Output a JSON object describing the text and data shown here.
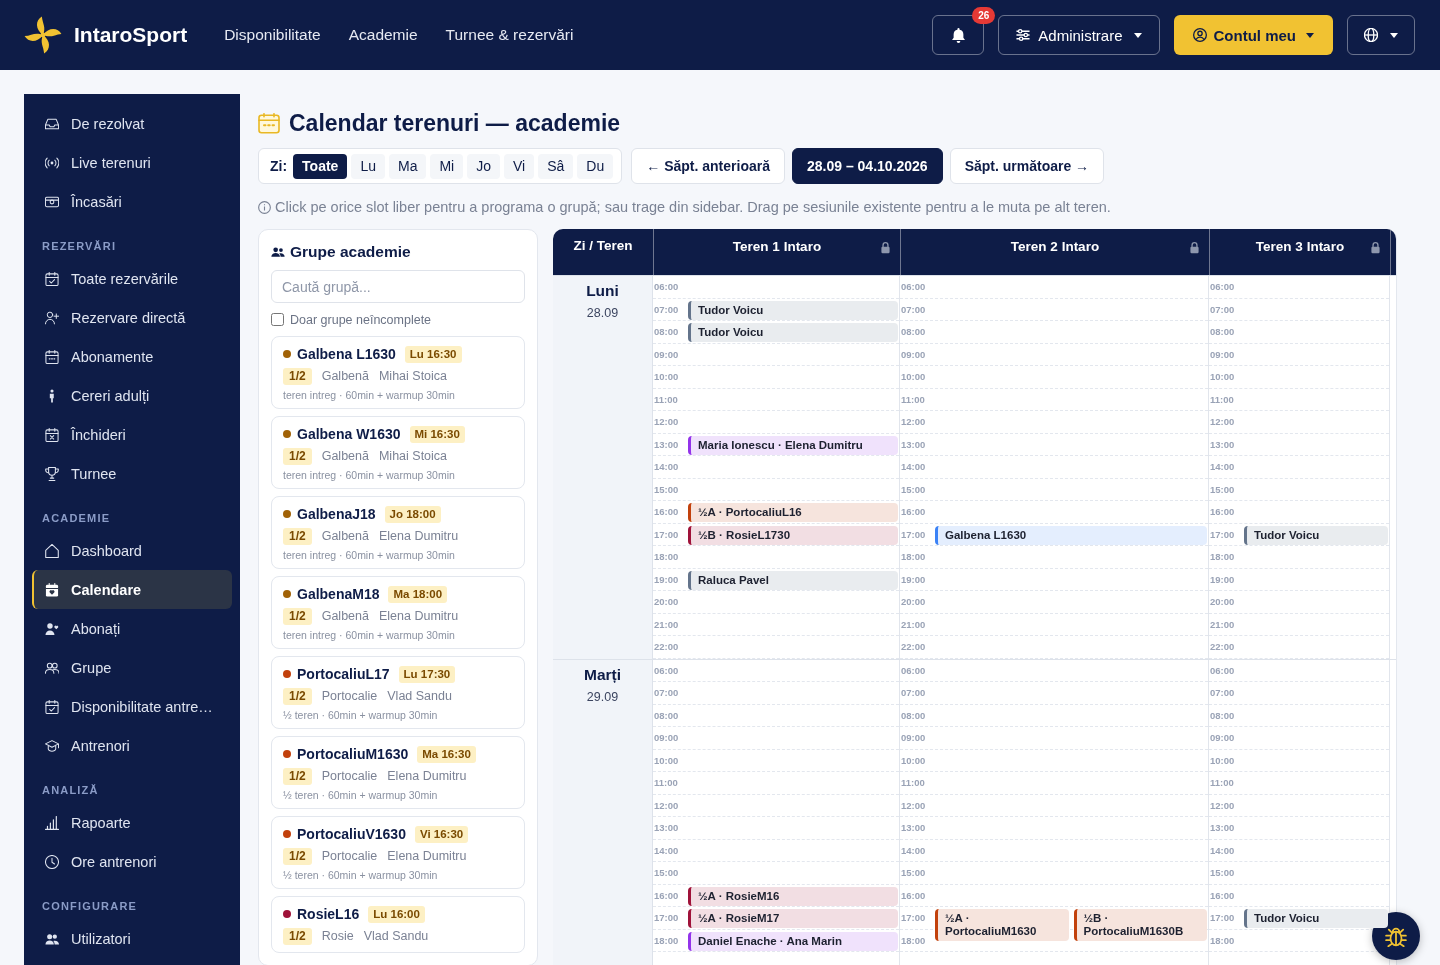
{
  "topbar": {
    "brand": "IntaroSport",
    "nav": [
      "Disponibilitate",
      "Academie",
      "Turnee & rezervări"
    ],
    "notifications": {
      "count": "26"
    },
    "admin_menu": {
      "label": "Administrare"
    },
    "account_menu": {
      "label": "Contul meu"
    }
  },
  "sidebar": {
    "sections": [
      {
        "items": [
          {
            "label": "De rezolvat",
            "selected": false
          },
          {
            "label": "Live terenuri",
            "selected": false
          },
          {
            "label": "Încasări",
            "selected": false
          }
        ]
      },
      {
        "title": "REZERVĂRI",
        "items": [
          {
            "label": "Toate rezervările",
            "selected": false
          },
          {
            "label": "Rezervare directă",
            "selected": false
          },
          {
            "label": "Abonamente",
            "selected": false
          },
          {
            "label": "Cereri adulți",
            "selected": false
          },
          {
            "label": "Închideri",
            "selected": false
          },
          {
            "label": "Turnee",
            "selected": false
          }
        ]
      },
      {
        "title": "ACADEMIE",
        "items": [
          {
            "label": "Dashboard",
            "selected": false
          },
          {
            "label": "Calendare",
            "selected": true
          },
          {
            "label": "Abonați",
            "selected": false
          },
          {
            "label": "Grupe",
            "selected": false
          },
          {
            "label": "Disponibilitate antre…",
            "selected": false
          },
          {
            "label": "Antrenori",
            "selected": false
          }
        ]
      },
      {
        "title": "ANALIZĂ",
        "items": [
          {
            "label": "Rapoarte",
            "selected": false
          },
          {
            "label": "Ore antrenori",
            "selected": false
          }
        ]
      },
      {
        "title": "CONFIGURARE",
        "items": [
          {
            "label": "Utilizatori",
            "selected": false
          }
        ]
      }
    ]
  },
  "page": {
    "title": "Calendar terenuri — academie",
    "day_filter": {
      "label": "Zi:",
      "options": [
        {
          "label": "Toate",
          "selected": true
        },
        {
          "label": "Lu",
          "selected": false
        },
        {
          "label": "Ma",
          "selected": false
        },
        {
          "label": "Mi",
          "selected": false
        },
        {
          "label": "Jo",
          "selected": false
        },
        {
          "label": "Vi",
          "selected": false
        },
        {
          "label": "Sâ",
          "selected": false
        },
        {
          "label": "Du",
          "selected": false
        }
      ]
    },
    "week_nav": {
      "previous": "← Săpt. anterioară",
      "range": "28.09 – 04.10.2026",
      "next": "Săpt. următoare →"
    },
    "hint": "Click pe orice slot liber pentru a programa o grupă; sau trage din sidebar. Drag pe sesiunile existente pentru a le muta pe alt teren."
  },
  "groups_panel": {
    "title": "Grupe academie",
    "search": {
      "placeholder": "Caută grupă..."
    },
    "filter": {
      "label": "Doar grupe neîncomplete",
      "checked": false
    },
    "groups": [
      {
        "name": "Galbena L1630",
        "color": "#a16207",
        "schedule": "Lu 16:30",
        "capacity": "1/2",
        "category": "Galbenă",
        "coach": "Mihai Stoica",
        "details": "teren intreg · 60min + warmup 30min"
      },
      {
        "name": "Galbena W1630",
        "color": "#a16207",
        "schedule": "Mi 16:30",
        "capacity": "1/2",
        "category": "Galbenă",
        "coach": "Mihai Stoica",
        "details": "teren intreg · 60min + warmup 30min"
      },
      {
        "name": "GalbenaJ18",
        "color": "#a16207",
        "schedule": "Jo 18:00",
        "capacity": "1/2",
        "category": "Galbenă",
        "coach": "Elena Dumitru",
        "details": "teren intreg · 60min + warmup 30min"
      },
      {
        "name": "GalbenaM18",
        "color": "#a16207",
        "schedule": "Ma 18:00",
        "capacity": "1/2",
        "category": "Galbenă",
        "coach": "Elena Dumitru",
        "details": "teren intreg · 60min + warmup 30min"
      },
      {
        "name": "PortocaliuL17",
        "color": "#c2410c",
        "schedule": "Lu 17:30",
        "capacity": "1/2",
        "category": "Portocalie",
        "coach": "Vlad Sandu",
        "details": "½ teren · 60min + warmup 30min"
      },
      {
        "name": "PortocaliuM1630",
        "color": "#c2410c",
        "schedule": "Ma 16:30",
        "capacity": "1/2",
        "category": "Portocalie",
        "coach": "Elena Dumitru",
        "details": "½ teren · 60min + warmup 30min"
      },
      {
        "name": "PortocaliuV1630",
        "color": "#c2410c",
        "schedule": "Vi 16:30",
        "capacity": "1/2",
        "category": "Portocalie",
        "coach": "Elena Dumitru",
        "details": "½ teren · 60min + warmup 30min"
      },
      {
        "name": "RosieL16",
        "color": "#9f1239",
        "schedule": "Lu 16:00",
        "capacity": "1/2",
        "category": "Rosie",
        "coach": "Vlad Sandu"
      }
    ]
  },
  "calendar": {
    "corner": "Zi / Teren",
    "courts": [
      {
        "name": "Teren 1 Intaro",
        "locked": true
      },
      {
        "name": "Teren 2 Intaro",
        "locked": true
      },
      {
        "name": "Teren 3 Intaro",
        "locked": true
      }
    ],
    "days": [
      {
        "name": "Luni",
        "date": "28.09",
        "columns": [
          {
            "slots": [
              {
                "time": "06:00"
              },
              {
                "time": "07:00",
                "events": [
                  {
                    "title": "Tudor Voicu",
                    "color": "#64748b"
                  }
                ]
              },
              {
                "time": "08:00",
                "events": [
                  {
                    "title": "Tudor Voicu",
                    "color": "#64748b"
                  }
                ]
              },
              {
                "time": "09:00"
              },
              {
                "time": "10:00"
              },
              {
                "time": "11:00"
              },
              {
                "time": "12:00"
              },
              {
                "time": "13:00",
                "events": [
                  {
                    "title": "Maria Ionescu · Elena Dumitru",
                    "color": "#9333ea"
                  }
                ]
              },
              {
                "time": "14:00"
              },
              {
                "time": "15:00"
              },
              {
                "time": "16:00",
                "events": [
                  {
                    "title": "½A · PortocaliuL16",
                    "color": "#c2410c"
                  }
                ]
              },
              {
                "time": "17:00",
                "events": [
                  {
                    "title": "½B · RosieL1730",
                    "color": "#9f1239"
                  }
                ]
              },
              {
                "time": "18:00"
              },
              {
                "time": "19:00",
                "events": [
                  {
                    "title": "Raluca Pavel",
                    "color": "#64748b"
                  }
                ]
              },
              {
                "time": "20:00"
              },
              {
                "time": "21:00"
              },
              {
                "time": "22:00"
              }
            ]
          },
          {
            "slots": [
              {
                "time": "06:00"
              },
              {
                "time": "07:00"
              },
              {
                "time": "08:00"
              },
              {
                "time": "09:00"
              },
              {
                "time": "10:00"
              },
              {
                "time": "11:00"
              },
              {
                "time": "12:00"
              },
              {
                "time": "13:00"
              },
              {
                "time": "14:00"
              },
              {
                "time": "15:00"
              },
              {
                "time": "16:00"
              },
              {
                "time": "17:00",
                "events": [
                  {
                    "title": "Galbena L1630",
                    "color": "#3b82f6"
                  }
                ]
              },
              {
                "time": "18:00"
              },
              {
                "time": "19:00"
              },
              {
                "time": "20:00"
              },
              {
                "time": "21:00"
              },
              {
                "time": "22:00"
              }
            ]
          },
          {
            "slots": [
              {
                "time": "06:00"
              },
              {
                "time": "07:00"
              },
              {
                "time": "08:00"
              },
              {
                "time": "09:00"
              },
              {
                "time": "10:00"
              },
              {
                "time": "11:00"
              },
              {
                "time": "12:00"
              },
              {
                "time": "13:00"
              },
              {
                "time": "14:00"
              },
              {
                "time": "15:00"
              },
              {
                "time": "16:00"
              },
              {
                "time": "17:00",
                "events": [
                  {
                    "title": "Tudor Voicu",
                    "color": "#64748b"
                  }
                ]
              },
              {
                "time": "18:00"
              },
              {
                "time": "19:00"
              },
              {
                "time": "20:00"
              },
              {
                "time": "21:00"
              },
              {
                "time": "22:00"
              }
            ]
          }
        ]
      },
      {
        "name": "Marți",
        "date": "29.09",
        "columns": [
          {
            "slots": [
              {
                "time": "06:00"
              },
              {
                "time": "07:00"
              },
              {
                "time": "08:00"
              },
              {
                "time": "09:00"
              },
              {
                "time": "10:00"
              },
              {
                "time": "11:00"
              },
              {
                "time": "12:00"
              },
              {
                "time": "13:00"
              },
              {
                "time": "14:00"
              },
              {
                "time": "15:00"
              },
              {
                "time": "16:00",
                "events": [
                  {
                    "title": "½A · RosieM16",
                    "color": "#9f1239"
                  }
                ]
              },
              {
                "time": "17:00",
                "events": [
                  {
                    "title": "½A · RosieM17",
                    "color": "#9f1239"
                  }
                ]
              },
              {
                "time": "18:00",
                "events": [
                  {
                    "title": "Daniel Enache · Ana Marin",
                    "color": "#9333ea"
                  }
                ]
              }
            ]
          },
          {
            "slots": [
              {
                "time": "06:00"
              },
              {
                "time": "07:00"
              },
              {
                "time": "08:00"
              },
              {
                "time": "09:00"
              },
              {
                "time": "10:00"
              },
              {
                "time": "11:00"
              },
              {
                "time": "12:00"
              },
              {
                "time": "13:00"
              },
              {
                "time": "14:00"
              },
              {
                "time": "15:00"
              },
              {
                "time": "16:00"
              },
              {
                "time": "17:00",
                "events": [
                  {
                    "title": "½A · PortocaliuM1630",
                    "color": "#c2410c"
                  },
                  {
                    "title": "½B · PortocaliuM1630B",
                    "color": "#c2410c"
                  }
                ]
              },
              {
                "time": "18:00"
              }
            ]
          },
          {
            "slots": [
              {
                "time": "06:00"
              },
              {
                "time": "07:00"
              },
              {
                "time": "08:00"
              },
              {
                "time": "09:00"
              },
              {
                "time": "10:00"
              },
              {
                "time": "11:00"
              },
              {
                "time": "12:00"
              },
              {
                "time": "13:00"
              },
              {
                "time": "14:00"
              },
              {
                "time": "15:00"
              },
              {
                "time": "16:00"
              },
              {
                "time": "17:00",
                "events": [
                  {
                    "title": "Tudor Voicu",
                    "color": "#64748b"
                  }
                ]
              },
              {
                "time": "18:00"
              }
            ]
          }
        ]
      }
    ]
  }
}
